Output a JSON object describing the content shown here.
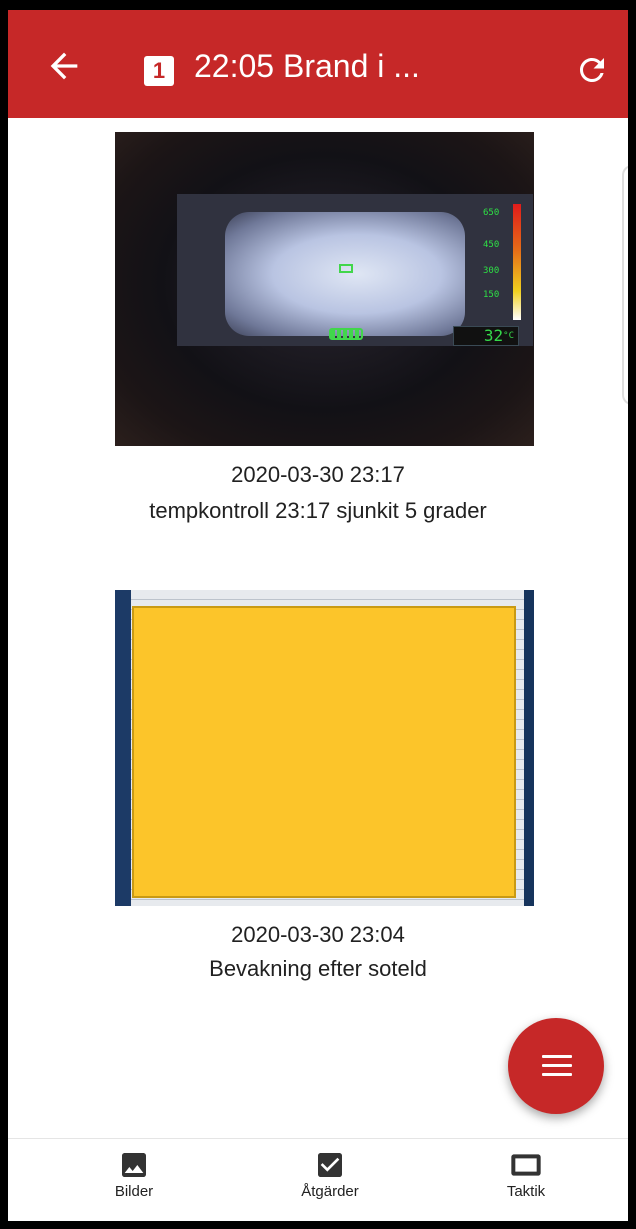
{
  "header": {
    "title": "22:05 Brand i ...",
    "badge": "1",
    "back_icon": "arrow-left-icon",
    "refresh_icon": "refresh-icon",
    "color": "#c62828"
  },
  "feed": [
    {
      "timestamp": "2020-03-30 23:17",
      "caption": "tempkontroll 23:17 sjunkit 5 grader"
    },
    {
      "timestamp": "2020-03-30 23:04",
      "caption": "Bevakning efter soteld"
    }
  ],
  "thermal_overlay": {
    "scale_ticks": [
      "650",
      "450",
      "300",
      "150"
    ],
    "temperature": "32",
    "unit": "°C"
  },
  "fab": {
    "icon": "menu-icon"
  },
  "bottom_nav": [
    {
      "label": "Bilder",
      "icon": "image-icon"
    },
    {
      "label": "Åtgärder",
      "icon": "checkbox-icon"
    },
    {
      "label": "Taktik",
      "icon": "tablet-icon"
    }
  ],
  "colors": {
    "accent": "#c62828",
    "redaction": "#fcc52a"
  }
}
